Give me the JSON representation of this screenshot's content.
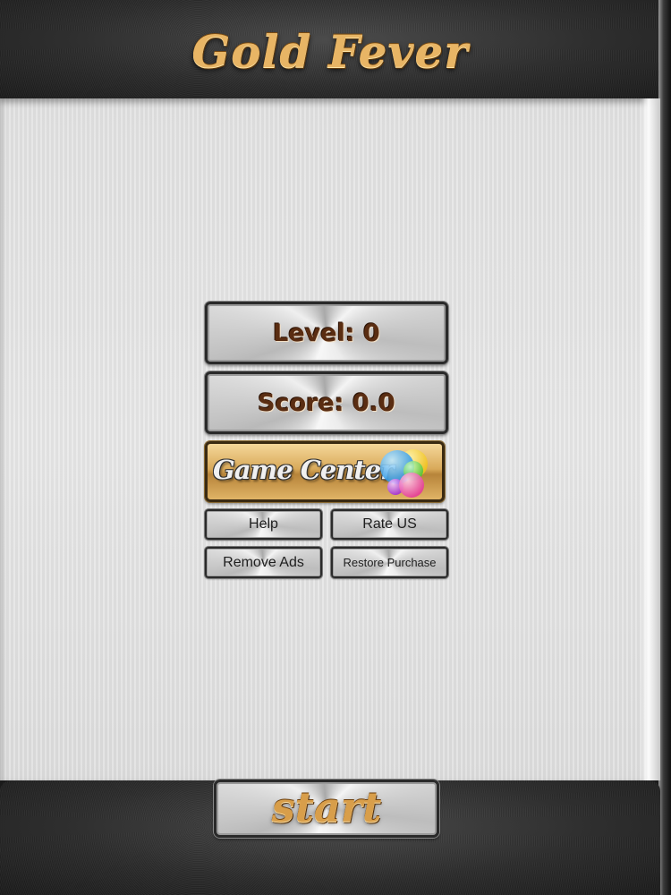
{
  "header": {
    "title": "Gold Fever"
  },
  "stats": {
    "level_label": "Level: 0",
    "score_label": "Score: 0.0"
  },
  "menu": {
    "game_center_label": "Game Center",
    "game_center_icon": "game-center-bubbles-icon",
    "help_label": "Help",
    "rate_label": "Rate US",
    "remove_ads_label": "Remove Ads",
    "restore_label": "Restore Purchase"
  },
  "footer": {
    "start_label": "start"
  },
  "colors": {
    "gold_text": "#e8b565",
    "brown_text": "#5a2d12",
    "gold_button": "#d9aa5a",
    "panel_light": "#e2e2e2",
    "metal_dark": "#2c2c2c"
  }
}
